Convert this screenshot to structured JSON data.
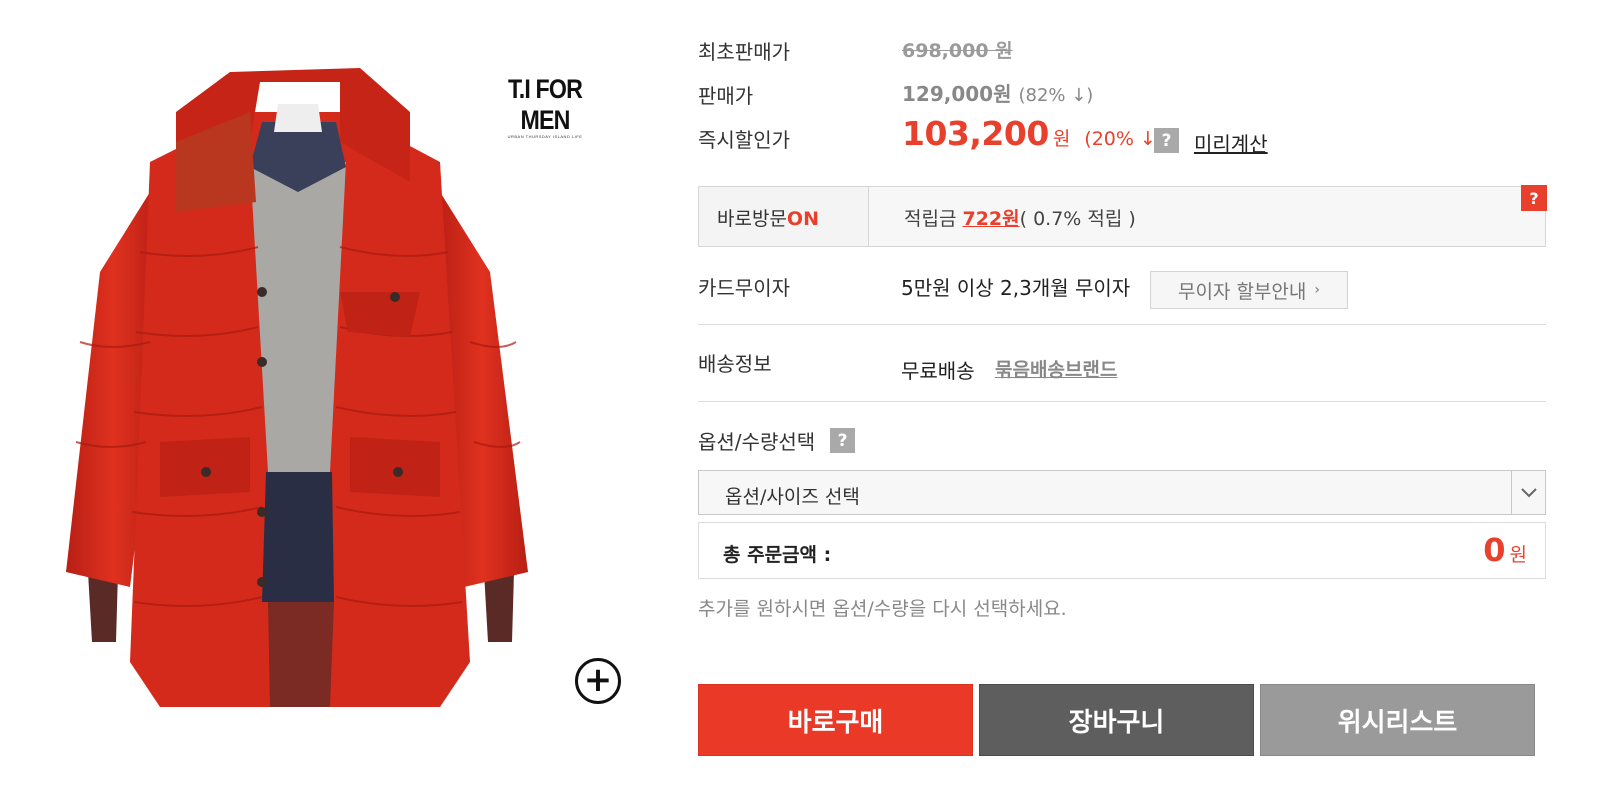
{
  "product": {
    "image_alt": "red padded long coat on mannequin",
    "brand": {
      "name": "T.I FOR MEN",
      "tagline": "URBAN THURSDAY ISLAND LIFE"
    },
    "zoom_icon": "zoom-plus-icon"
  },
  "pricing": {
    "original_label": "최초판매가",
    "original_price": "698,000 원",
    "sale_label": "판매가",
    "sale_price": "129,000원",
    "sale_rate": "(82% ↓)",
    "instant_label": "즉시할인가",
    "instant_price": "103,200",
    "instant_unit": "원",
    "instant_rate": "(20% ↓)",
    "help_icon": "?",
    "precalc_link": "미리계산"
  },
  "visit": {
    "label": "바로방문",
    "label_on": "ON",
    "points_prefix": "적립금 ",
    "points_amount": "722원",
    "points_rate": "( 0.7% 적립 )",
    "help_icon": "?"
  },
  "card": {
    "label": "카드무이자",
    "text": "5만원 이상 2,3개월 무이자",
    "button": "무이자 할부안내",
    "chevron": "›"
  },
  "shipping": {
    "label": "배송정보",
    "text": "무료배송",
    "link": "묶음배송브랜드"
  },
  "options": {
    "label": "옵션/수량선택",
    "help_icon": "?",
    "select_value": "옵션/사이즈 선택"
  },
  "total": {
    "label": "총 주문금액 :",
    "amount": "0",
    "unit": "원"
  },
  "notice": "추가를 원하시면 옵션/수량을 다시 선택하세요.",
  "buttons": {
    "buy": "바로구매",
    "cart": "장바구니",
    "wish": "위시리스트"
  },
  "colors": {
    "accent": "#e8402c",
    "coat_red": "#d42a1c",
    "cart_gray": "#5e5e5e",
    "wish_gray": "#9a9a9a"
  }
}
